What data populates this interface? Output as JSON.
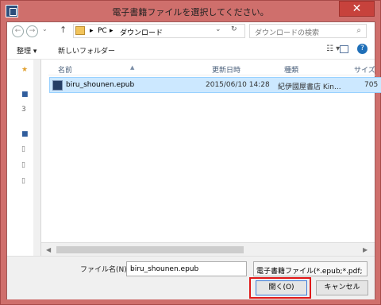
{
  "window": {
    "title": "電子書籍ファイルを選択してください。",
    "close": "✕"
  },
  "address": {
    "pc": "PC",
    "separator": "▸",
    "folder": "ダウンロード",
    "dropdown": "⌄",
    "refresh": "↻"
  },
  "search": {
    "placeholder": "ダウンロードの検索",
    "icon": "⌕"
  },
  "toolbar": {
    "organize": "整理 ▾",
    "new_folder": "新しいフォルダー",
    "view": "☷ ▾",
    "help": "?"
  },
  "navigation": {
    "back": "←",
    "forward": "→",
    "dropdown": "⌄",
    "up": "↑"
  },
  "left_pane": {
    "items": [
      "★",
      "■",
      "3",
      "■",
      "▯",
      "▯",
      "▯"
    ]
  },
  "columns": {
    "name": "名前",
    "date": "更新日時",
    "type": "種類",
    "size": "サイズ",
    "sort": "▲"
  },
  "files": [
    {
      "name": "biru_shounen.epub",
      "date": "2015/06/10 14:28",
      "type": "紀伊國屋書店 Kin...",
      "size": "705"
    }
  ],
  "bottom": {
    "filename_label": "ファイル名(N):",
    "filename": "biru_shounen.epub",
    "filetype": "電子書籍ファイル(*.epub;*.pdf;",
    "open": "開く(O)",
    "cancel": "キャンセル"
  },
  "colors": {
    "frame": "#cf6f6c",
    "selection": "#cce8ff",
    "highlight": "#e01818"
  }
}
